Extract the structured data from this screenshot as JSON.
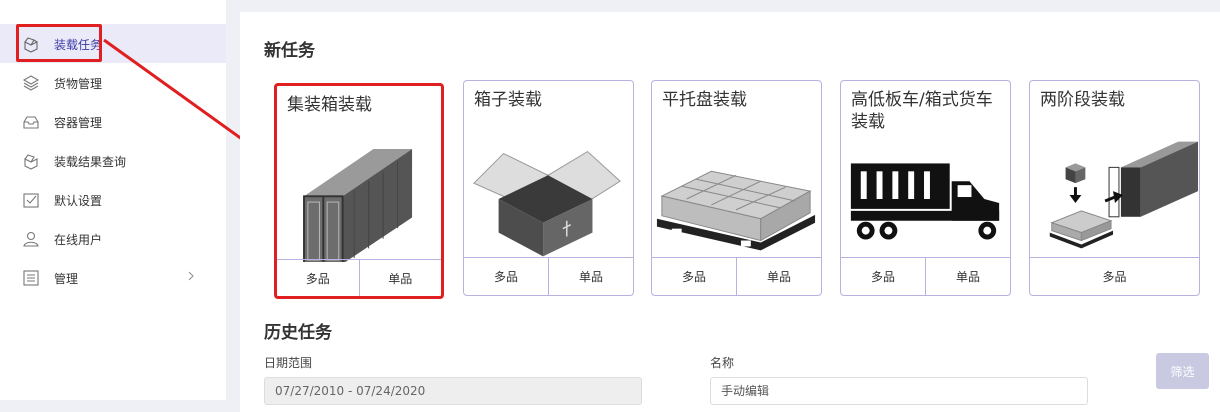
{
  "sidebar": {
    "items": [
      {
        "label": "装载任务",
        "icon": "box-open-icon",
        "active": true
      },
      {
        "label": "货物管理",
        "icon": "layers-icon"
      },
      {
        "label": "容器管理",
        "icon": "tray-icon"
      },
      {
        "label": "装载结果查询",
        "icon": "box-search-icon"
      },
      {
        "label": "默认设置",
        "icon": "checkbox-icon"
      },
      {
        "label": "在线用户",
        "icon": "user-icon"
      },
      {
        "label": "管理",
        "icon": "list-icon",
        "has_submenu": true
      }
    ]
  },
  "new_task": {
    "heading": "新任务",
    "cards": [
      {
        "title": "集装箱装载",
        "buttons": [
          "多品",
          "单品"
        ],
        "art": "container-icon",
        "selected": true
      },
      {
        "title": "箱子装载",
        "buttons": [
          "多品",
          "单品"
        ],
        "art": "open-box-icon"
      },
      {
        "title": "平托盘装载",
        "buttons": [
          "多品",
          "单品"
        ],
        "art": "pallet-icon"
      },
      {
        "title": "高低板车/箱式货车装载",
        "buttons": [
          "多品",
          "单品"
        ],
        "art": "truck-icon"
      },
      {
        "title": "两阶段装载",
        "buttons": [
          "多品"
        ],
        "art": "two-stage-icon"
      }
    ]
  },
  "history": {
    "heading": "历史任务",
    "date_range_label": "日期范围",
    "date_range_value": "07/27/2010 - 07/24/2020",
    "name_label": "名称",
    "name_value": "手动编辑",
    "filter_label": "筛选"
  },
  "colors": {
    "accent": "#3b3ba6",
    "active_bg": "#ebeaf8",
    "card_border": "#b7b3e0",
    "highlight_red": "#e02020",
    "filter_btn": "#c9c9e2"
  }
}
